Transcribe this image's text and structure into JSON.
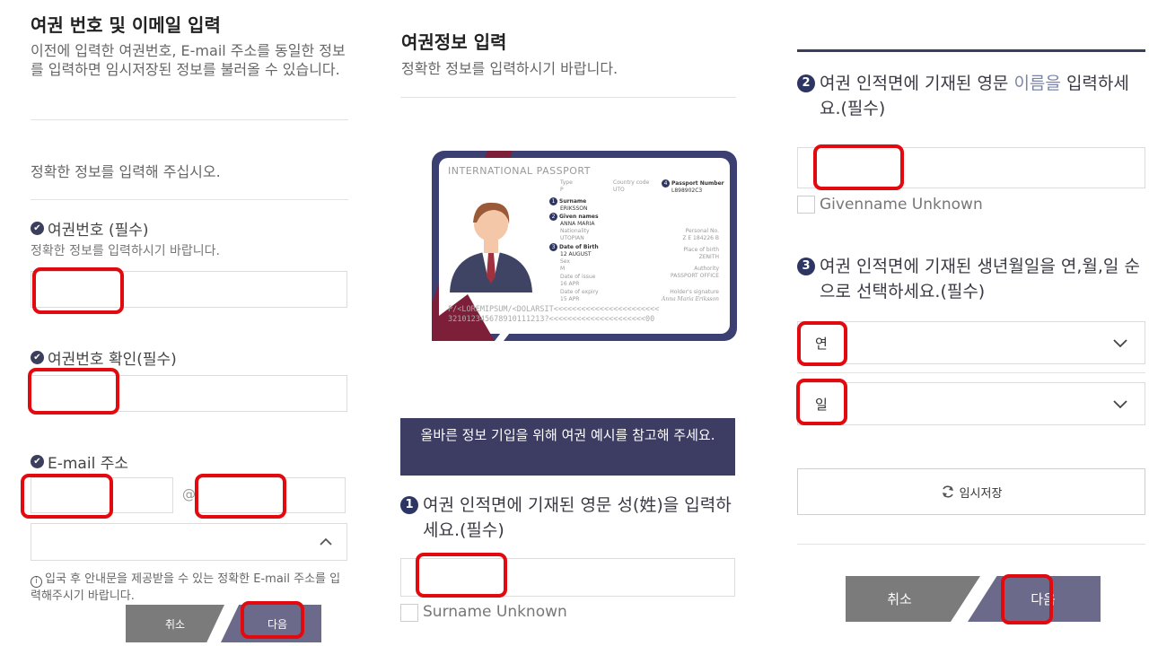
{
  "left": {
    "title": "여권 번호 및 이메일 입력",
    "desc": "이전에 입력한 여권번호, E-mail 주소를 동일한 정보를 입력하면 임시저장된 정보를 불러올 수 있습니다.",
    "notice": "정확한 정보를 입력해 주십시오.",
    "passport_label": "여권번호 (필수)",
    "passport_hint": "정확한 정보를 입력하시기 바랍니다.",
    "passport_confirm_label": "여권번호 확인(필수)",
    "email_label": "E-mail 주소",
    "at": "@",
    "info": "입국 후 안내문을 제공받을 수 있는 정확한 E-mail 주소를 입력해주시기 바랍니다.",
    "cancel": "취소",
    "next": "다음"
  },
  "middle": {
    "title": "여권정보 입력",
    "desc": "정확한 정보를 입력하시기 바랍니다.",
    "passport_card": {
      "header": "INTERNATIONAL PASSPORT",
      "type_label": "Type",
      "type_val": "P",
      "country_label": "Country code",
      "country_val": "UTO",
      "num_label": "Passport Number",
      "num_val": "L898902C3",
      "surname_label": "Surname",
      "surname_val": "ERIKSSON",
      "given_label": "Given names",
      "given_val": "ANNA MARIA",
      "nationality_label": "Nationality",
      "nationality_val": "UTOPIAN",
      "personal_label": "Personal No.",
      "personal_val": "Z E 184226 B",
      "dob_label": "Date of Birth",
      "dob_val": "12 AUGUST",
      "pob_label": "Place of birth",
      "pob_val": "ZENITH",
      "sex_label": "Sex",
      "sex_val": "M",
      "issue_label": "Date of issue",
      "issue_val": "16 APR",
      "authority_label": "Authority",
      "authority_val": "PASSPORT OFFICE",
      "expiry_label": "Date of expiry",
      "expiry_val": "15 APR",
      "signature_label": "Holder's signature",
      "signature_val": "Anna Maria Eriksson",
      "mrz1": "P/<LOREMIPSUM/<DOLARSIT<<<<<<<<<<<<<<<<<<<<<<<",
      "mrz2": "321012345678910111213?<<<<<<<<<<<<<<<<<<<<<00"
    },
    "banner": "올바른 정보 기입을 위해 여권 예시를 참고해 주세요.",
    "q1_num": "1",
    "q1": "여권 인적면에 기재된 영문 성(姓)을 입력하세요.(필수)",
    "surname_unknown": "Surname Unknown"
  },
  "right": {
    "q2_num": "2",
    "q2_a": "여권 인적면에 기재된 영문",
    "q2_b": "이름을",
    "q2_c": "입력하세요.(필수)",
    "given_unknown": "Givenname Unknown",
    "q3_num": "3",
    "q3": "여권 인적면에 기재된 생년월일을 연,월,일 순으로 선택하세요.(필수)",
    "year_value": "연",
    "day_value": "일",
    "temp_save": "임시저장",
    "cancel": "취소",
    "next": "다음"
  }
}
